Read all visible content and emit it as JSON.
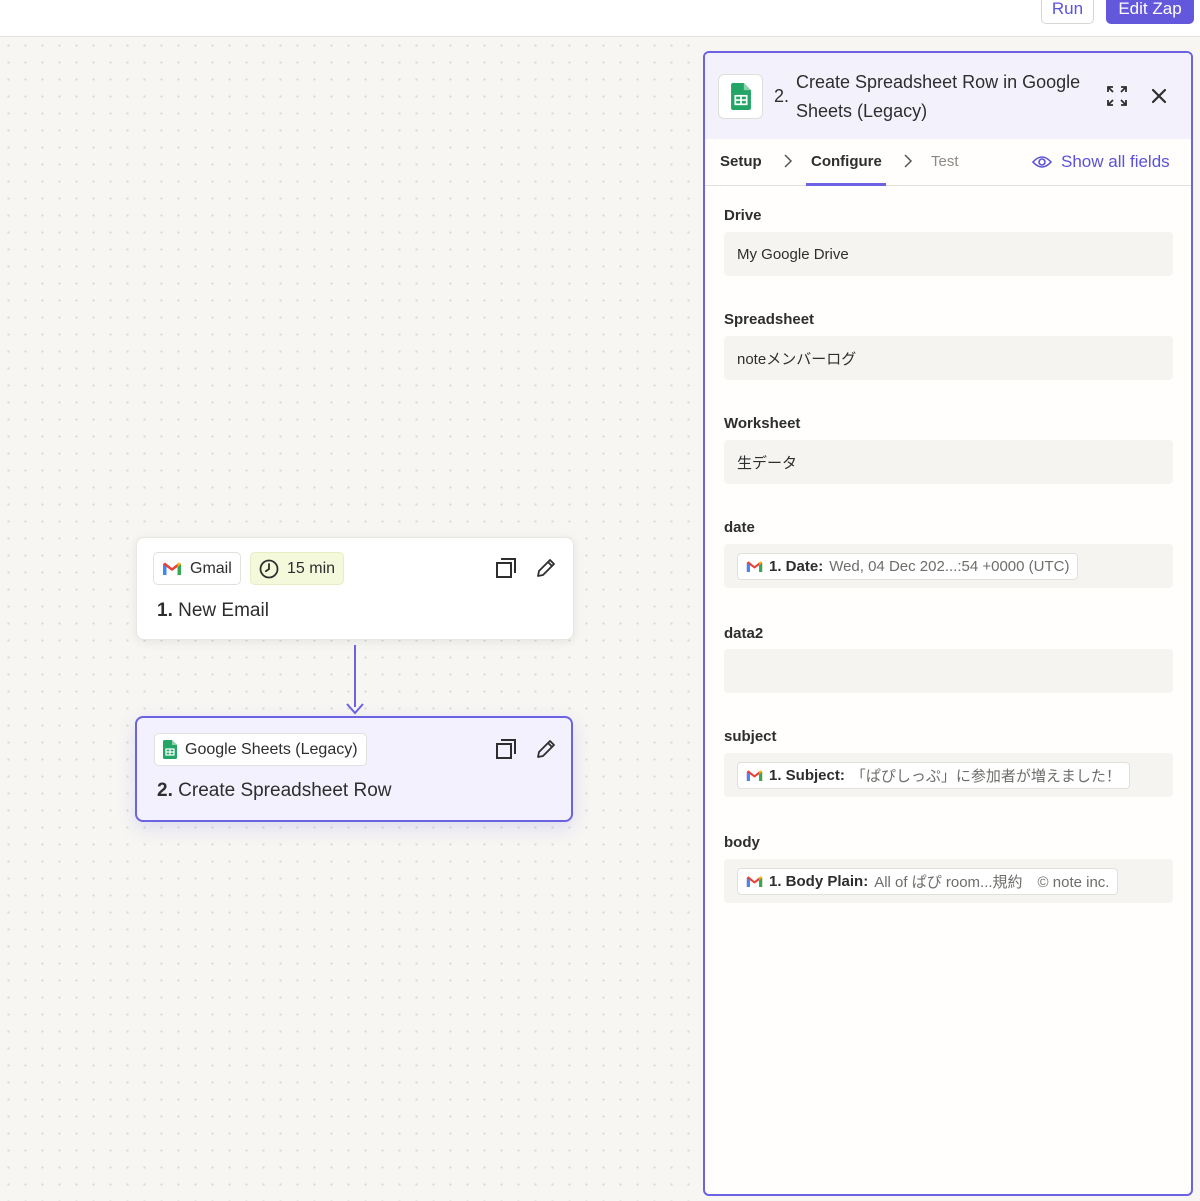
{
  "topbar": {
    "run_label": "Run",
    "edit_label": "Edit Zap"
  },
  "canvas": {
    "step1": {
      "app_chip": "Gmail",
      "time_chip": "15 min",
      "num": "1.",
      "title": "New Email"
    },
    "step2": {
      "app_chip": "Google Sheets (Legacy)",
      "num": "2.",
      "title": "Create Spreadsheet Row"
    }
  },
  "panel": {
    "step_num": "2.",
    "title": "Create Spreadsheet Row in Google Sheets (Legacy)",
    "tabs": [
      "Setup",
      "Configure",
      "Test"
    ],
    "show_all_fields": "Show all fields",
    "fields": {
      "drive": {
        "label": "Drive",
        "value": "My Google Drive"
      },
      "spreadsheet": {
        "label": "Spreadsheet",
        "value": "noteメンバーログ"
      },
      "worksheet": {
        "label": "Worksheet",
        "value": "生データ"
      },
      "date": {
        "label": "date",
        "pill_key": "1. Date:",
        "pill_value": "Wed, 04 Dec 202...:54 +0000 (UTC)"
      },
      "data2": {
        "label": "data2",
        "value": ""
      },
      "subject": {
        "label": "subject",
        "pill_key": "1. Subject:",
        "pill_value": "「ぱぴしっぷ」に参加者が増えました！"
      },
      "body": {
        "label": "body",
        "pill_key": "1. Body Plain:",
        "pill_value": "All of ぱぴ room...規約　© note inc."
      }
    }
  },
  "colors": {
    "accent": "#6c62e2",
    "sheets_green": "#23a566"
  }
}
